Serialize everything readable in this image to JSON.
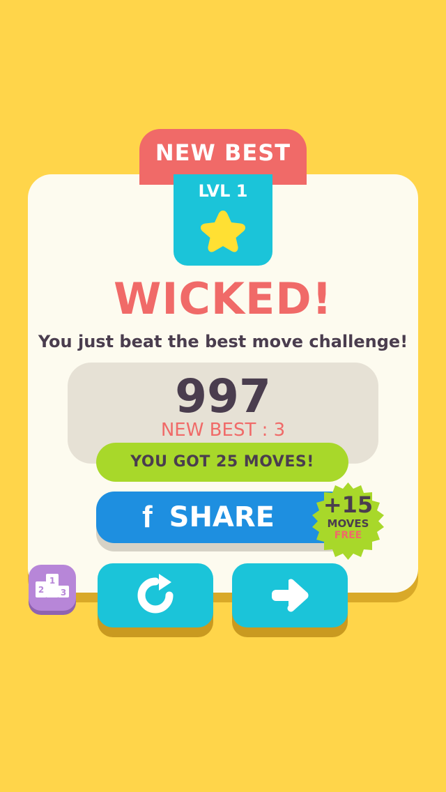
{
  "header": {
    "tab_label": "NEW BEST"
  },
  "level": {
    "label": "LVL 1",
    "icon": "star-icon"
  },
  "result": {
    "headline": "WICKED!",
    "message": "You just beat the best move challenge!"
  },
  "score": {
    "value": "997",
    "best_text": "NEW BEST : 3"
  },
  "moves_banner": "YOU GOT 25 MOVES!",
  "share": {
    "icon_glyph": "f",
    "label": "SHARE",
    "bonus_amount": "+15",
    "bonus_unit": "MOVES",
    "bonus_note": "FREE"
  },
  "buttons": {
    "leaderboard_icon": "podium-icon",
    "retry_icon": "retry-icon",
    "next_icon": "arrow-right-icon"
  },
  "colors": {
    "background": "#FFD54A",
    "accent_red": "#F06A68",
    "accent_cyan": "#1BC4D9",
    "accent_green": "#A8D82A",
    "accent_blue": "#1E8FE0",
    "accent_purple": "#B786D8",
    "text_dark": "#4A3D4E"
  }
}
